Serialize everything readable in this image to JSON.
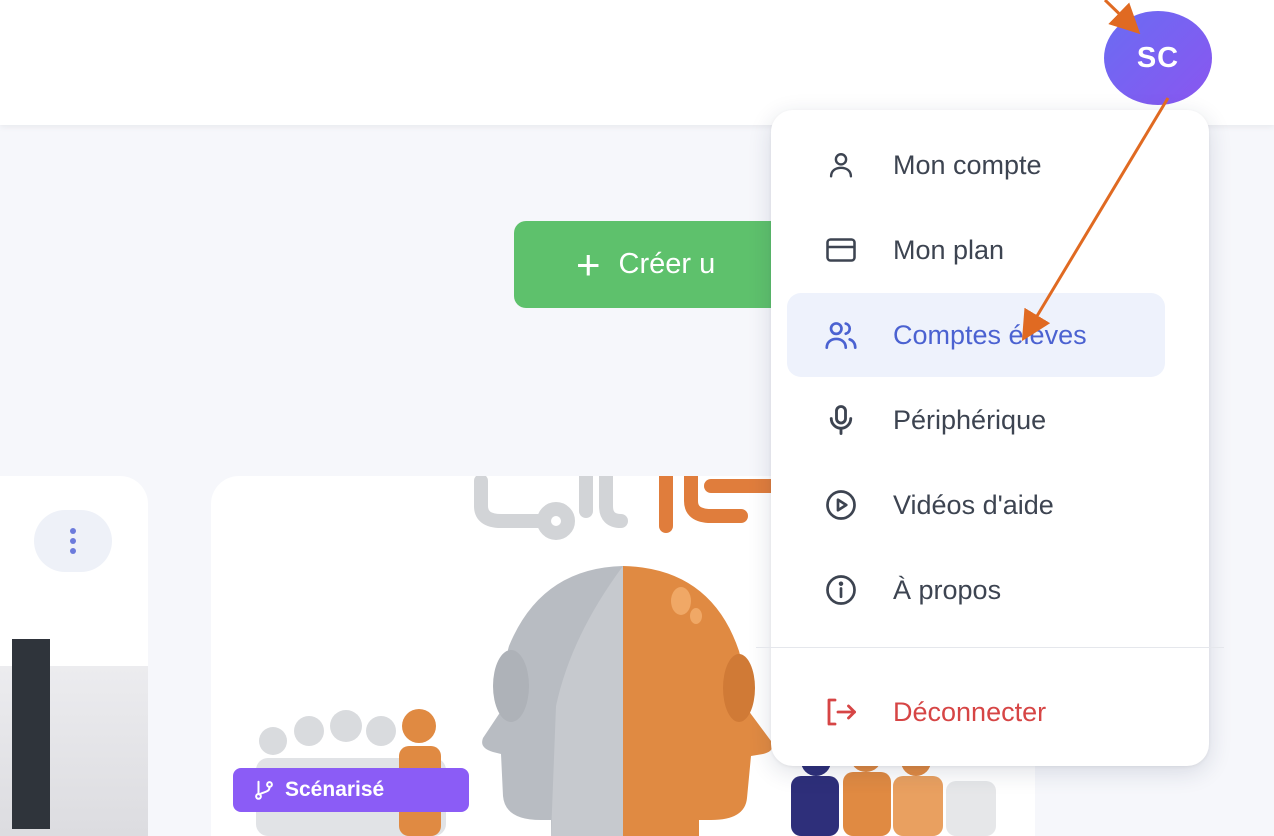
{
  "header": {
    "avatar_initials": "SC"
  },
  "main": {
    "create_button_label": "Créer u"
  },
  "cards": [
    {
      "badge_label": "Scénarisé"
    }
  ],
  "user_menu": {
    "items": [
      {
        "label": "Mon compte",
        "icon": "user-icon"
      },
      {
        "label": "Mon plan",
        "icon": "credit-card-icon"
      },
      {
        "label": "Comptes élèves",
        "icon": "users-icon",
        "active": true
      },
      {
        "label": "Périphérique",
        "icon": "microphone-icon"
      },
      {
        "label": "Vidéos d'aide",
        "icon": "play-circle-icon"
      },
      {
        "label": "À propos",
        "icon": "info-icon"
      }
    ],
    "logout_label": "Déconnecter"
  },
  "colors": {
    "accent": "#4b62d1",
    "create_button": "#5ec16c",
    "avatar": "#7462f2",
    "badge": "#8b5cf6",
    "danger": "#d64545",
    "annotation_arrow": "#e06a22"
  }
}
